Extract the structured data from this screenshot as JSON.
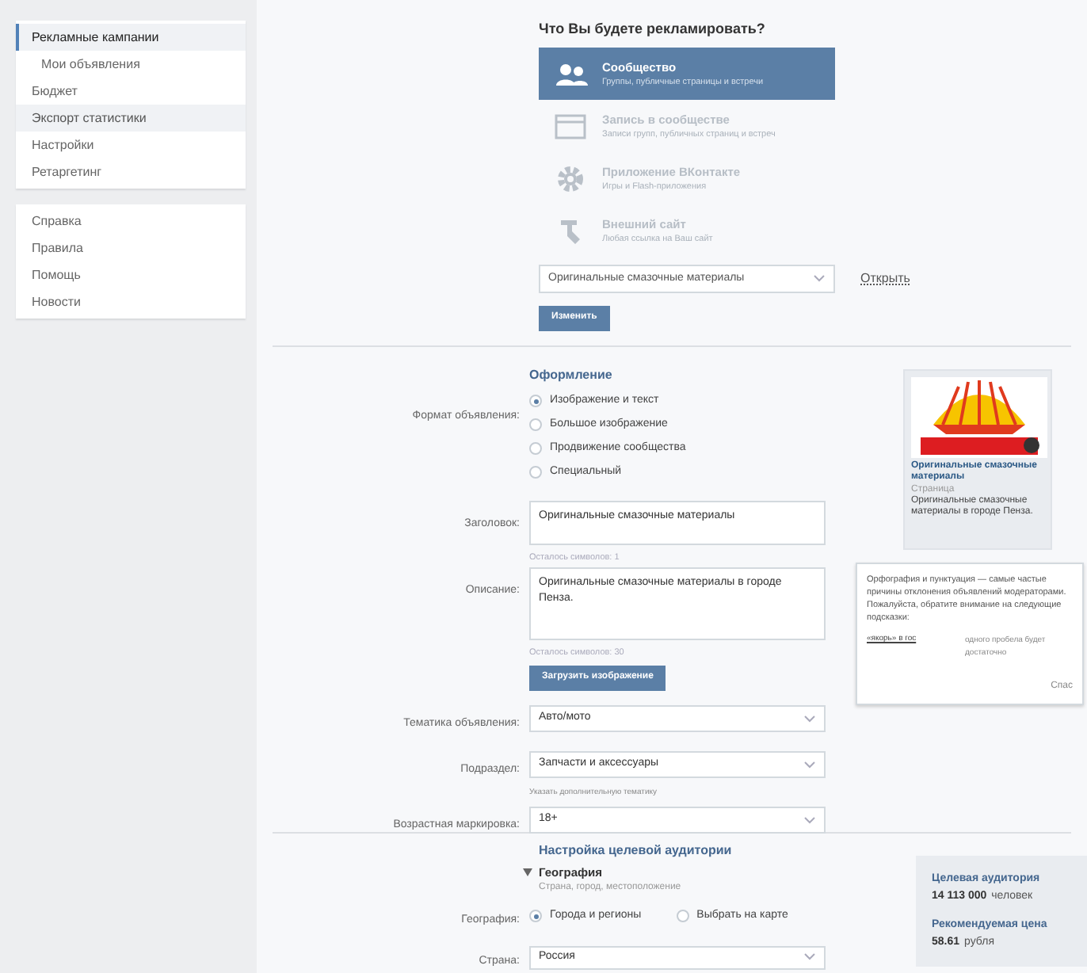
{
  "sidebar": {
    "groups": [
      {
        "items": [
          {
            "label": "Рекламные кампании",
            "selected": true,
            "sub": false
          },
          {
            "label": "Мои объявления",
            "selected": false,
            "sub": true
          },
          {
            "label": "Бюджет",
            "selected": false,
            "sub": false
          },
          {
            "label": "Экспорт статистики",
            "selected": false,
            "hover": true,
            "sub": false
          },
          {
            "label": "Настройки",
            "selected": false,
            "sub": false
          },
          {
            "label": "Ретаргетинг",
            "selected": false,
            "sub": false
          }
        ]
      },
      {
        "items": [
          {
            "label": "Справка",
            "selected": false,
            "sub": false
          },
          {
            "label": "Правила",
            "selected": false,
            "sub": false
          },
          {
            "label": "Помощь",
            "selected": false,
            "sub": false
          },
          {
            "label": "Новости",
            "selected": false,
            "sub": false
          }
        ]
      }
    ]
  },
  "object": {
    "title": "Что Вы будете рекламировать?",
    "options": [
      {
        "kind": "community",
        "title": "Сообщество",
        "subtitle": "Группы, публичные страницы и встречи",
        "selected": true
      },
      {
        "kind": "post",
        "title": "Запись в сообществе",
        "subtitle": "Записи групп, публичных страниц и встреч",
        "selected": false
      },
      {
        "kind": "app",
        "title": "Приложение ВКонтакте",
        "subtitle": "Игры и Flash-приложения",
        "selected": false
      },
      {
        "kind": "site",
        "title": "Внешний сайт",
        "subtitle": "Любая ссылка на Ваш сайт",
        "selected": false
      }
    ],
    "community_select": "Оригинальные смазочные материалы",
    "open_link": "Открыть",
    "button": "Изменить"
  },
  "design": {
    "title": "Оформление",
    "format_label": "Формат объявления:",
    "formats": [
      {
        "label": "Изображение и текст",
        "selected": true
      },
      {
        "label": "Большое изображение",
        "selected": false
      },
      {
        "label": "Продвижение сообщества",
        "selected": false
      },
      {
        "label": "Специальный",
        "selected": false
      }
    ],
    "heading_label": "Заголовок:",
    "heading_value": "Оригинальные смазочные материалы",
    "heading_left": "Осталось символов: 1",
    "description_label": "Описание:",
    "description_value": "Оригинальные смазочные материалы  в городе Пенза.",
    "description_left": "Осталось символов: 30",
    "upload_button": "Загрузить изображение",
    "topic_label": "Тематика объявления:",
    "topic_value": "Авто/мото",
    "subsection_label": "Подраздел:",
    "subsection_value": "Запчасти и аксессуары",
    "extra_topic_link": "Указать дополнительную тематику",
    "age_label": "Возрастная маркировка:",
    "age_value": "18+"
  },
  "preview": {
    "title": "Оригинальные смазочные материалы",
    "type": "Страница",
    "text": "Оригинальные смазочные материалы в городе Пенза."
  },
  "tip": {
    "text": "Орфография и пунктуация — самые частые причины отклонения объявлений модераторами. Пожалуйста, обратите внимание на следующие подсказки:",
    "example": "«якорь» в гос",
    "advice": "одного пробела будет достаточно",
    "close": "Спас"
  },
  "audience": {
    "title": "Настройка целевой аудитории",
    "section": "География",
    "section_hint": "Страна, город, местоположение",
    "expanded": true,
    "geo_label": "География:",
    "geo_options": [
      {
        "label": "Города и регионы",
        "selected": true
      },
      {
        "label": "Выбрать на карте",
        "selected": false
      }
    ],
    "country_label": "Страна:",
    "country_value": "Россия"
  },
  "summary": {
    "audience_title": "Целевая аудитория",
    "audience_count": "14 113 000",
    "audience_unit": "человек",
    "price_title": "Рекомендуемая цена",
    "price_value": "58.61",
    "price_unit": "рубля"
  }
}
